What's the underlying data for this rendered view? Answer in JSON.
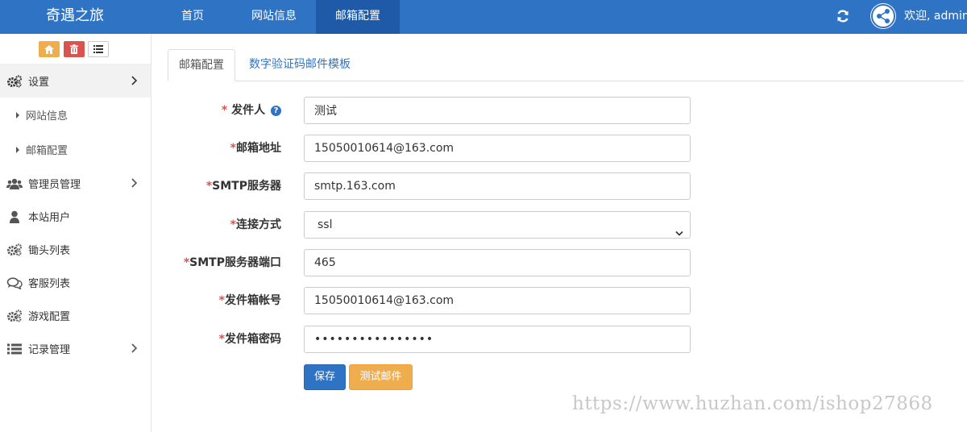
{
  "header": {
    "brand": "奇遇之旅",
    "nav": [
      {
        "label": "首页",
        "active": false
      },
      {
        "label": "网站信息",
        "active": false
      },
      {
        "label": "邮箱配置",
        "active": true
      }
    ],
    "welcome": "欢迎, admin",
    "color": "#2f73c4"
  },
  "sidebar": {
    "items": [
      {
        "label": "设置",
        "icon": "gears-icon",
        "expanded": true
      },
      {
        "label": "管理员管理",
        "icon": "users-icon"
      },
      {
        "label": "本站用户",
        "icon": "user-icon"
      },
      {
        "label": "锄头列表",
        "icon": "gears-icon"
      },
      {
        "label": "客服列表",
        "icon": "chat-icon"
      },
      {
        "label": "游戏配置",
        "icon": "gears-icon"
      },
      {
        "label": "记录管理",
        "icon": "list-icon"
      }
    ],
    "subitems": [
      {
        "label": "网站信息"
      },
      {
        "label": "邮箱配置"
      }
    ]
  },
  "tabs": [
    {
      "label": "邮箱配置",
      "active": true
    },
    {
      "label": "数字验证码邮件模板",
      "active": false
    }
  ],
  "form": {
    "sender": {
      "label": "发件人",
      "value": "测试"
    },
    "email": {
      "label": "邮箱地址",
      "value": "15050010614@163.com"
    },
    "smtp": {
      "label": "SMTP服务器",
      "value": "smtp.163.com"
    },
    "conn": {
      "label": "连接方式",
      "value": "ssl"
    },
    "port": {
      "label": "SMTP服务器端口",
      "value": "465"
    },
    "account": {
      "label": "发件箱帐号",
      "value": "15050010614@163.com"
    },
    "password": {
      "label": "发件箱密码",
      "value": "••••••••••••••••"
    },
    "required_mark": "*"
  },
  "buttons": {
    "save": "保存",
    "test": "测试邮件"
  },
  "watermark": "https://www.huzhan.com/ishop27868"
}
